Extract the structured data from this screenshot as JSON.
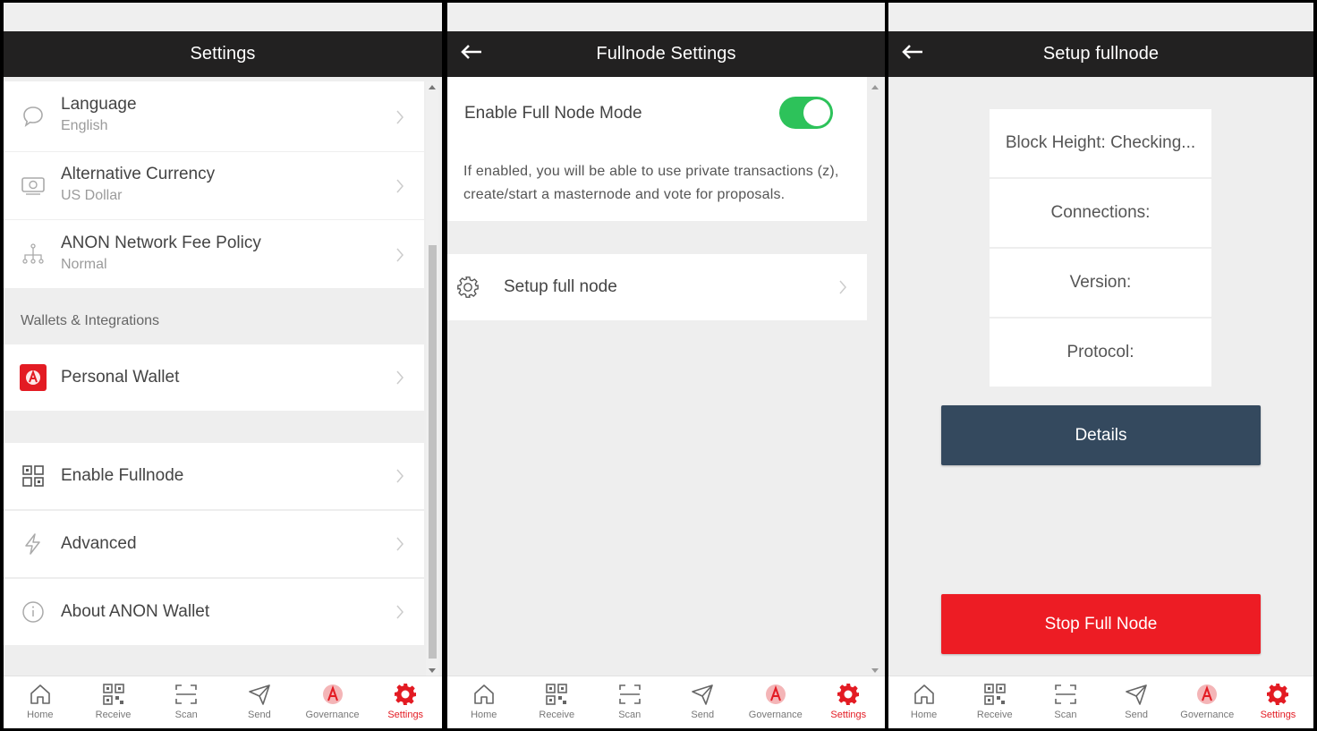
{
  "colors": {
    "header_bg": "#222121",
    "accent_red": "#e31b23",
    "toggle_on": "#2dc25a",
    "details_btn": "#34495e"
  },
  "tabbar": {
    "items": [
      {
        "label": "Home",
        "icon": "home-icon"
      },
      {
        "label": "Receive",
        "icon": "qr-icon"
      },
      {
        "label": "Scan",
        "icon": "scan-icon"
      },
      {
        "label": "Send",
        "icon": "send-icon"
      },
      {
        "label": "Governance",
        "icon": "governance-icon"
      },
      {
        "label": "Settings",
        "icon": "gear-icon",
        "active": true
      }
    ]
  },
  "panel1": {
    "title": "Settings",
    "rows": [
      {
        "title": "Language",
        "sub": "English",
        "icon": "chat-bubble-icon"
      },
      {
        "title": "Alternative Currency",
        "sub": "US Dollar",
        "icon": "currency-icon"
      },
      {
        "title": "ANON Network Fee Policy",
        "sub": "Normal",
        "icon": "network-icon"
      }
    ],
    "section_label": "Wallets & Integrations",
    "wallet": {
      "title": "Personal Wallet",
      "icon": "anon-wallet-icon"
    },
    "more_rows": [
      {
        "title": "Enable Fullnode",
        "icon": "qr-grid-icon"
      },
      {
        "title": "Advanced",
        "icon": "lightning-icon"
      },
      {
        "title": "About ANON Wallet",
        "icon": "info-icon"
      }
    ]
  },
  "panel2": {
    "title": "Fullnode Settings",
    "toggle_label": "Enable Full Node Mode",
    "toggle_on": true,
    "description": "If enabled, you will be able to use private transactions (z), create/start a masternode and vote for proposals.",
    "setup_label": "Setup full node"
  },
  "panel3": {
    "title": "Setup fullnode",
    "info": [
      "Block Height: Checking...",
      "Connections:",
      "Version:",
      "Protocol:"
    ],
    "details_button": "Details",
    "stop_button": "Stop Full Node"
  }
}
